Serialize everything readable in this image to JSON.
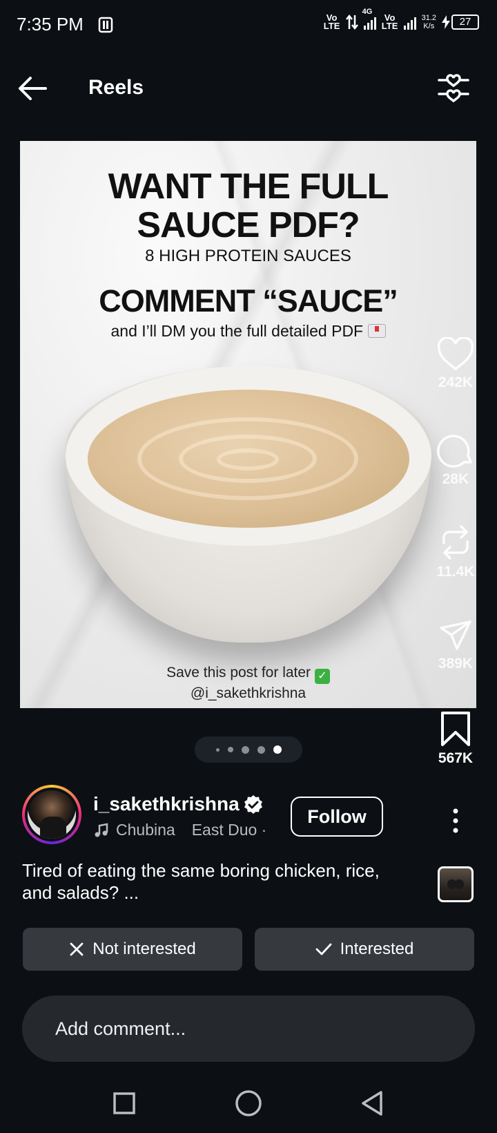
{
  "status_bar": {
    "time": "7:35 PM",
    "volte1": "Vo LTE",
    "network": "4G",
    "volte2": "Vo LTE",
    "speed_value": "31.2",
    "speed_unit": "K/s",
    "battery": "27"
  },
  "header": {
    "title": "Reels",
    "back_icon": "arrow-left-icon",
    "filter_icon": "heart-sliders-icon"
  },
  "post": {
    "headline": "WANT THE FULL SAUCE PDF?",
    "subheadline": "8 HIGH PROTEIN SAUCES",
    "cta": "COMMENT “SAUCE”",
    "cta_sub": "and I’ll DM you the full detailed PDF",
    "save_text": "Save this post for later",
    "handle": "@i_sakethkrishna"
  },
  "actions": {
    "likes": "242K",
    "comments": "28K",
    "reposts": "11.4K",
    "shares": "389K",
    "saves": "567K"
  },
  "carousel": {
    "total_dots": 5,
    "active_index": 4
  },
  "author": {
    "username": "i_sakethkrishna",
    "music_title": "Chubina",
    "music_artist": "East Duo ·",
    "follow_label": "Follow"
  },
  "caption": "Tired of eating the same boring chicken, rice, and salads? ...",
  "buttons": {
    "not_interested": "Not interested",
    "interested": "Interested"
  },
  "comment": {
    "placeholder": "Add comment..."
  },
  "colors": {
    "background": "#0c1014",
    "button_bg": "#363a3f",
    "input_bg": "#25292e"
  }
}
